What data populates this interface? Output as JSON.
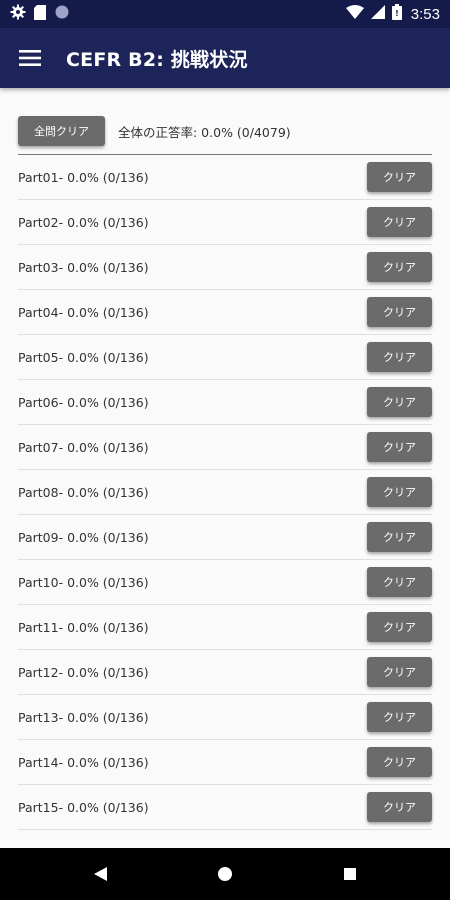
{
  "status_bar": {
    "time": "3:53",
    "icons": [
      "gear-icon",
      "sd-card-icon",
      "circle-icon",
      "wifi-icon",
      "signal-icon",
      "battery-icon"
    ]
  },
  "app_bar": {
    "title": "CEFR B2: 挑戦状況",
    "menu_icon": "hamburger-menu-icon"
  },
  "summary": {
    "clear_all_label": "全問クリア",
    "total_label": "全体の正答率: 0.0%  (0/4079)"
  },
  "parts": [
    {
      "label": "Part01-  0.0%  (0/136)",
      "button": "クリア"
    },
    {
      "label": "Part02-  0.0%  (0/136)",
      "button": "クリア"
    },
    {
      "label": "Part03-  0.0%  (0/136)",
      "button": "クリア"
    },
    {
      "label": "Part04-  0.0%  (0/136)",
      "button": "クリア"
    },
    {
      "label": "Part05-  0.0%  (0/136)",
      "button": "クリア"
    },
    {
      "label": "Part06-  0.0%  (0/136)",
      "button": "クリア"
    },
    {
      "label": "Part07-  0.0%  (0/136)",
      "button": "クリア"
    },
    {
      "label": "Part08-  0.0%  (0/136)",
      "button": "クリア"
    },
    {
      "label": "Part09-  0.0%  (0/136)",
      "button": "クリア"
    },
    {
      "label": "Part10-  0.0%  (0/136)",
      "button": "クリア"
    },
    {
      "label": "Part11-  0.0%  (0/136)",
      "button": "クリア"
    },
    {
      "label": "Part12-  0.0%  (0/136)",
      "button": "クリア"
    },
    {
      "label": "Part13-  0.0%  (0/136)",
      "button": "クリア"
    },
    {
      "label": "Part14-  0.0%  (0/136)",
      "button": "クリア"
    },
    {
      "label": "Part15-  0.0%  (0/136)",
      "button": "クリア"
    }
  ],
  "nav_bar": {
    "icons": [
      "back-triangle-icon",
      "home-circle-icon",
      "recents-square-icon"
    ]
  },
  "colors": {
    "status_bar": "#141a4a",
    "app_bar": "#1c2459",
    "button": "#6b6b6b",
    "background": "#fafafa"
  }
}
